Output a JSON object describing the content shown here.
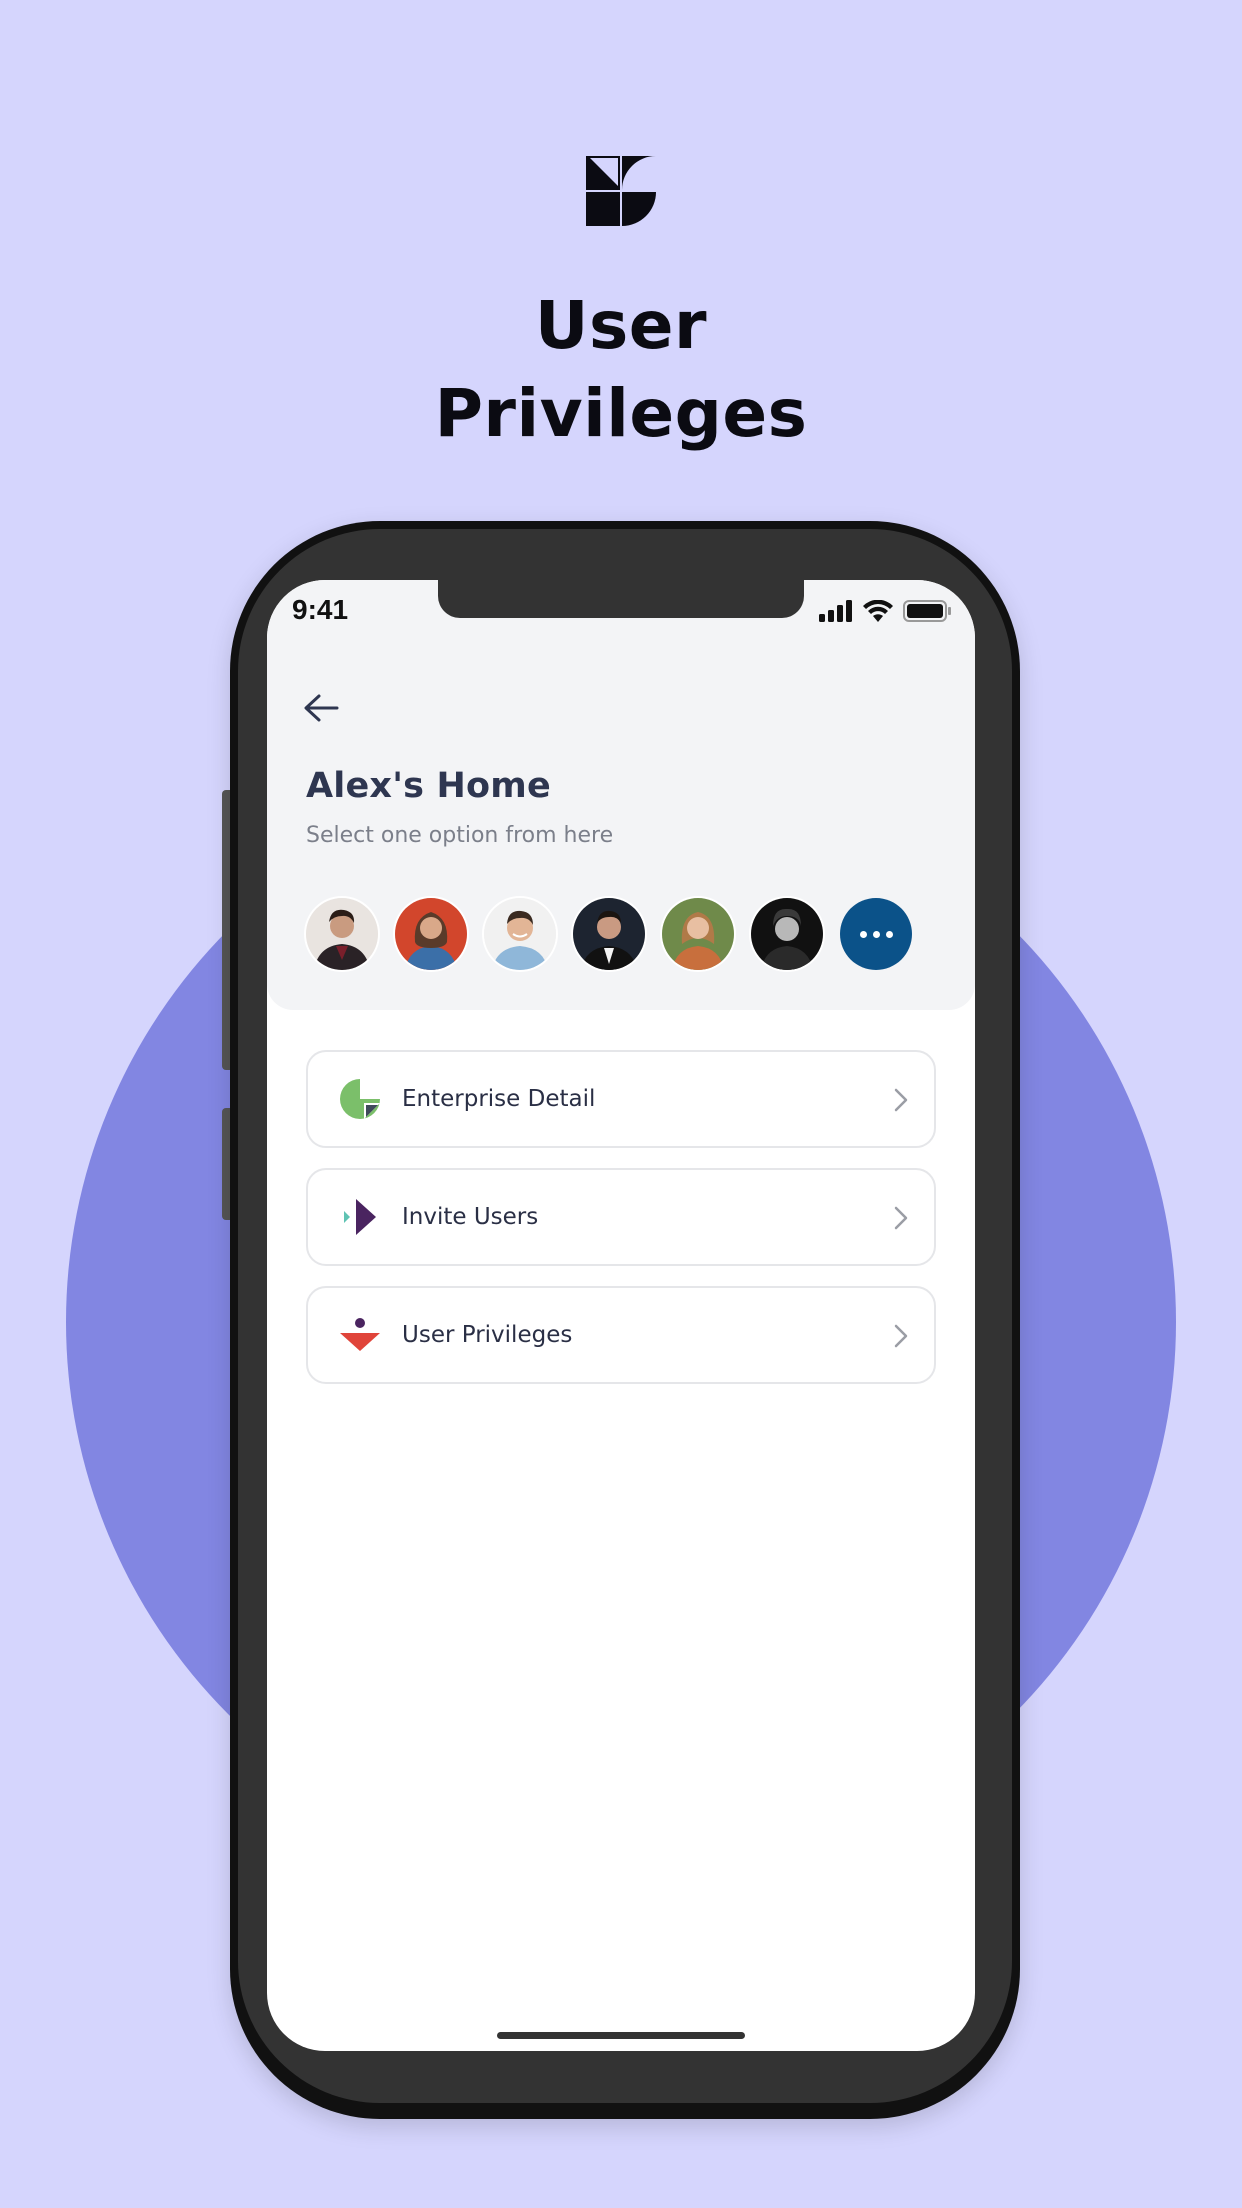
{
  "headline": {
    "line1": "User",
    "line2": "Privileges"
  },
  "status_bar": {
    "time": "9:41"
  },
  "header": {
    "title": "Alex's Home",
    "subtitle": "Select one option from here"
  },
  "avatars": [
    {
      "name": "avatar-1"
    },
    {
      "name": "avatar-2"
    },
    {
      "name": "avatar-3"
    },
    {
      "name": "avatar-4"
    },
    {
      "name": "avatar-5"
    },
    {
      "name": "avatar-6"
    }
  ],
  "menu": {
    "items": [
      {
        "label": "Enterprise Detail",
        "icon": "enterprise-icon"
      },
      {
        "label": "Invite Users",
        "icon": "invite-icon"
      },
      {
        "label": "User Privileges",
        "icon": "privileges-icon"
      }
    ]
  },
  "colors": {
    "page_background": "#d5d5fd",
    "circle": "#8286e2",
    "phone_frame": "#333333",
    "more_button": "#0b5289",
    "title_text": "#2e3650"
  }
}
